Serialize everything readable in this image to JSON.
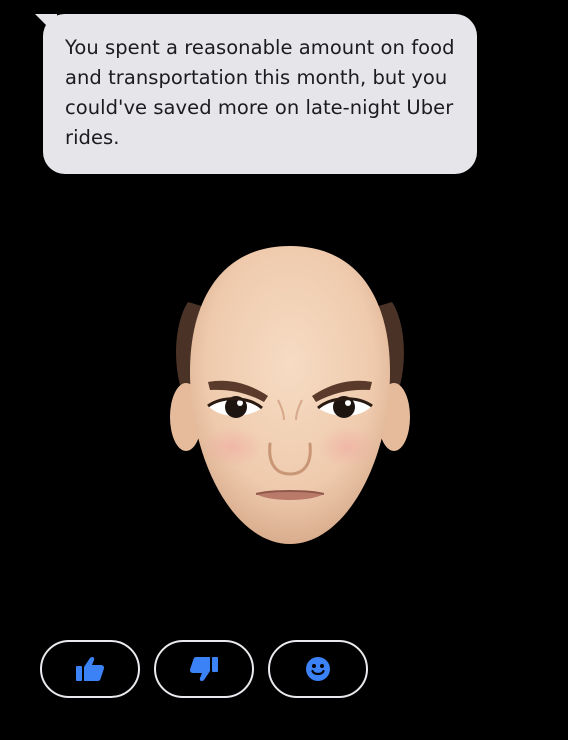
{
  "message": {
    "text": "You spent a reasonable amount on food and transportation this month, but you could've saved more on late-night Uber rides."
  },
  "avatar": {
    "icon": "memoji-face-icon"
  },
  "actions": [
    {
      "icon": "thumbs-up-icon"
    },
    {
      "icon": "thumbs-down-icon"
    },
    {
      "icon": "smiley-icon"
    }
  ],
  "colors": {
    "background": "#000000",
    "bubble": "#e5e5ea",
    "bubble_text": "#1c1c1e",
    "accent": "#3b82f6",
    "button_border": "#e9e9ee",
    "skin": "#f2d2b6"
  }
}
